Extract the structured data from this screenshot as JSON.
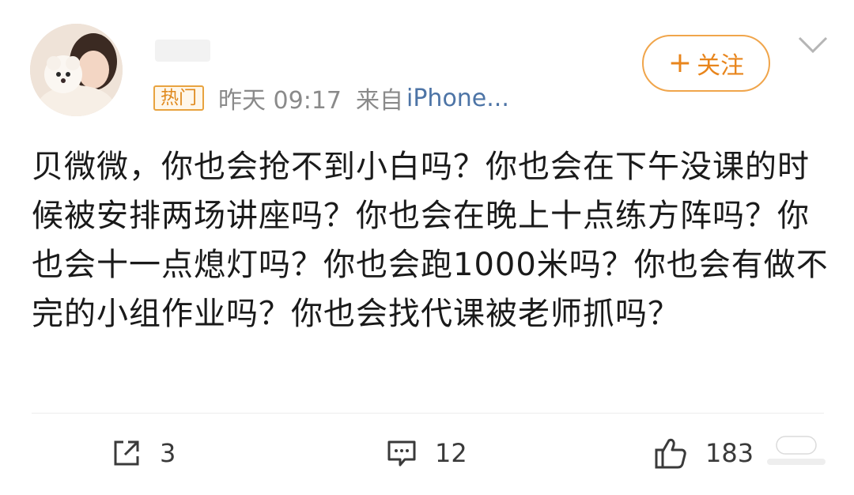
{
  "post": {
    "badge": "热门",
    "time": "昨天 09:17",
    "source_prefix": "来自",
    "source": "iPhone...",
    "follow_label": "关注",
    "text": "贝微微，你也会抢不到小白吗？你也会在下午没课的时候被安排两场讲座吗？你也会在晚上十点练方阵吗？你也会十一点熄灯吗？你也会跑1000米吗？你也会有做不完的小组作业吗？你也会找代课被老师抓吗？"
  },
  "actions": {
    "repost_count": "3",
    "comment_count": "12",
    "like_count": "183"
  },
  "icons": {
    "follow": "plus-icon",
    "menu": "chevron-down-icon",
    "repost": "repost-icon",
    "comment": "comment-icon",
    "like": "thumbs-up-icon"
  },
  "colors": {
    "accent": "#e8851c",
    "badge_border": "#e8a33f",
    "source_link": "#4d74a6",
    "meta_text": "#8a8a8a"
  }
}
